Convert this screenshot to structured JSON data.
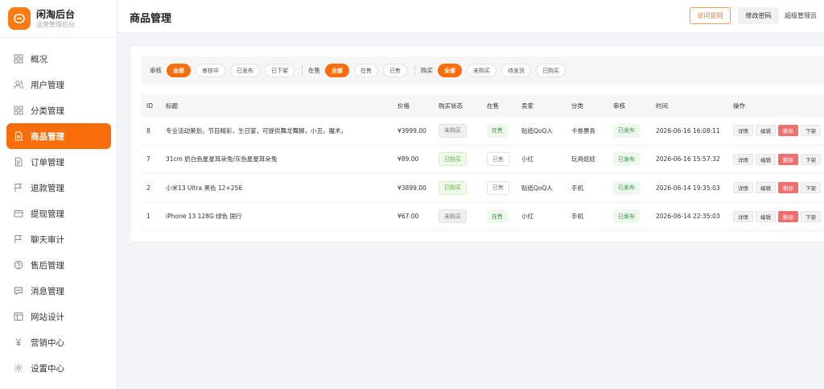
{
  "brand": {
    "title": "闲淘后台",
    "subtitle": "运营管理后台"
  },
  "sidebar": {
    "items": [
      {
        "label": "概况",
        "icon": "grid-icon"
      },
      {
        "label": "用户管理",
        "icon": "users-icon"
      },
      {
        "label": "分类管理",
        "icon": "category-icon"
      },
      {
        "label": "商品管理",
        "icon": "document-icon",
        "active": true
      },
      {
        "label": "订单管理",
        "icon": "order-icon"
      },
      {
        "label": "退款管理",
        "icon": "flag-icon"
      },
      {
        "label": "提现管理",
        "icon": "wallet-icon"
      },
      {
        "label": "聊天审计",
        "icon": "flag-icon"
      },
      {
        "label": "售后管理",
        "icon": "support-icon"
      },
      {
        "label": "消息管理",
        "icon": "message-icon"
      },
      {
        "label": "网站设计",
        "icon": "layout-icon"
      },
      {
        "label": "营销中心",
        "icon": "yen-icon"
      },
      {
        "label": "设置中心",
        "icon": "gear-icon"
      }
    ]
  },
  "header": {
    "title": "商品管理",
    "visit_label": "访问官网",
    "password_label": "修改密码",
    "role_label": "超级管理员"
  },
  "filters": {
    "audit": {
      "label": "审核",
      "options": [
        "全部",
        "审核中",
        "已发布",
        "已下架"
      ],
      "selected": 0
    },
    "stock": {
      "label": "在售",
      "options": [
        "全部",
        "在售",
        "已售"
      ],
      "selected": 0
    },
    "purchase": {
      "label": "购买",
      "options": [
        "全部",
        "未购买",
        "待发货",
        "已购买"
      ],
      "selected": 0
    }
  },
  "table": {
    "columns": [
      "ID",
      "标题",
      "价格",
      "购买状态",
      "在售",
      "卖家",
      "分类",
      "审核",
      "时间",
      "操作"
    ],
    "rows": [
      {
        "id": "8",
        "title": "专业活动策划，节目精彩，生日宴，可提供舞龙舞狮，小丑，魔术，",
        "price": "¥3999.00",
        "buy_status": "未购买",
        "buy_type": "notbought",
        "stock": "在售",
        "stock_type": "instock",
        "seller": "贴纸QoQ人",
        "category": "卡券票务",
        "audit": "已发布",
        "time": "2026-06-16 16:08:11"
      },
      {
        "id": "7",
        "title": "31cm 奶白色星星耳朵兔/灰色星星耳朵兔",
        "price": "¥89.00",
        "buy_status": "已购买",
        "buy_type": "bought",
        "stock": "已售",
        "stock_type": "sold",
        "seller": "小红",
        "category": "玩具娃娃",
        "audit": "已发布",
        "time": "2026-06-16 15:57:32"
      },
      {
        "id": "2",
        "title": "小米13 Ultra 黑色 12+256",
        "price": "¥3899.00",
        "buy_status": "已购买",
        "buy_type": "bought",
        "stock": "已售",
        "stock_type": "sold",
        "seller": "贴纸QoQ人",
        "category": "手机",
        "audit": "已发布",
        "time": "2026-06-14 19:35:03"
      },
      {
        "id": "1",
        "title": "iPhone 13 128G 绿色 国行",
        "price": "¥67.00",
        "buy_status": "未购买",
        "buy_type": "notbought",
        "stock": "在售",
        "stock_type": "instock",
        "seller": "小红",
        "category": "手机",
        "audit": "已发布",
        "time": "2026-06-14 22:35:03"
      }
    ],
    "ops": {
      "detail": "详情",
      "edit": "编辑",
      "delete": "删除",
      "offline": "下架"
    }
  },
  "colors": {
    "accent": "#fa6d0c",
    "danger": "#f26d6d",
    "success": "#2f9a47"
  }
}
